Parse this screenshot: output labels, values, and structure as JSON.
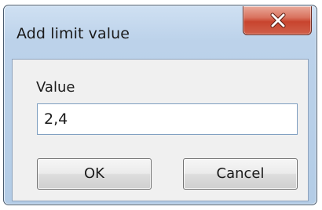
{
  "dialog": {
    "title": "Add limit value",
    "close_icon": "close-icon",
    "field_label": "Value",
    "field_value": "2,4",
    "ok_label": "OK",
    "cancel_label": "Cancel"
  },
  "colors": {
    "frame": "#bcd2ea",
    "close_button": "#c8442e",
    "client_background": "#f0f0f0",
    "input_border": "#7d9ec0"
  }
}
